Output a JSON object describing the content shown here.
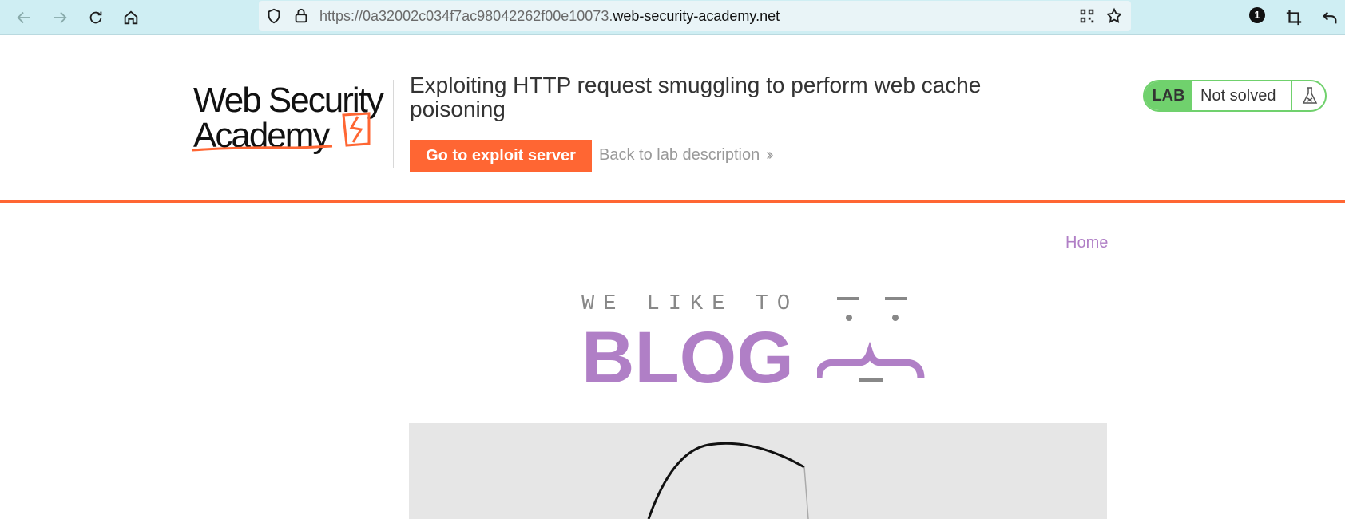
{
  "browser": {
    "url_prefix": "https://0a32002c034f7ac98042262f00e10073.",
    "url_domain": "web-security-academy.net",
    "extension_badge": "1",
    "icons": [
      "back-icon",
      "forward-icon",
      "reload-icon",
      "home-icon",
      "shield-icon",
      "lock-icon",
      "qr-code-icon",
      "star-icon",
      "crop-icon",
      "undo-icon"
    ]
  },
  "lab": {
    "logo_text_line1": "Web Security",
    "logo_text_line2": "Academy",
    "title": "Exploiting HTTP request smuggling to perform web cache poisoning",
    "exploit_button": "Go to exploit server",
    "back_link": "Back to lab description",
    "status_label": "LAB",
    "status_value": "Not solved",
    "accent_color": "#ff6633",
    "status_color": "#70d16d"
  },
  "blog": {
    "nav_home": "Home",
    "tagline": "WE LIKE TO",
    "brand": "BLOG",
    "brand_color": "#b07fc6"
  }
}
